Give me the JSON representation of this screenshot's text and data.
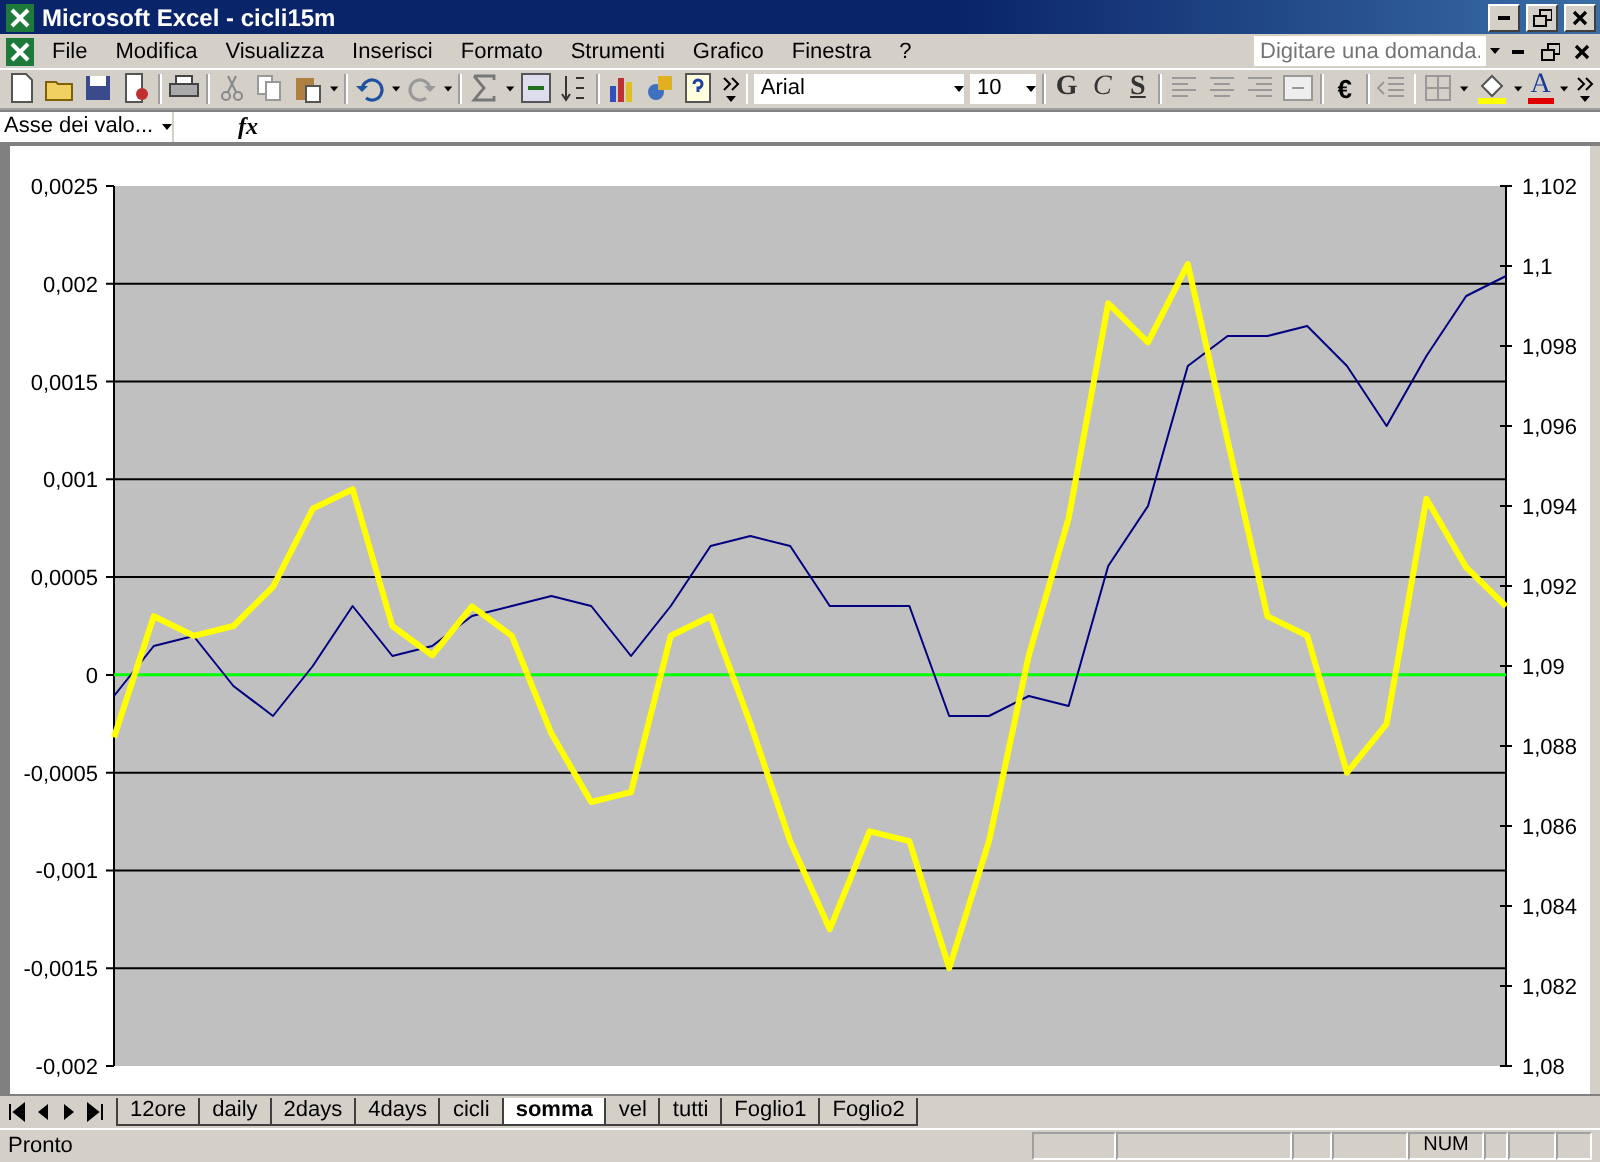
{
  "window": {
    "title": "Microsoft Excel - cicli15m"
  },
  "menu": [
    "File",
    "Modifica",
    "Visualizza",
    "Inserisci",
    "Formato",
    "Strumenti",
    "Grafico",
    "Finestra",
    "?"
  ],
  "help_box": {
    "placeholder": "Digitare una domanda."
  },
  "toolbar": {
    "font": "Arial",
    "font_size": "10",
    "format_buttons": [
      "G",
      "C",
      "S"
    ],
    "euro": "€",
    "font_color": "A"
  },
  "formula_bar": {
    "name_box": "Asse dei valo...",
    "fx": "fx"
  },
  "chart": {
    "chart_data": {
      "type": "line",
      "grid": true,
      "ylim": [
        -0.002,
        0.0025
      ],
      "yticks": [
        {
          "value": 0.0025,
          "label": "0,0025"
        },
        {
          "value": 0.002,
          "label": "0,002"
        },
        {
          "value": 0.0015,
          "label": "0,0015"
        },
        {
          "value": 0.001,
          "label": "0,001"
        },
        {
          "value": 0.0005,
          "label": "0,0005"
        },
        {
          "value": 0,
          "label": "0"
        },
        {
          "value": -0.0005,
          "label": "-0,0005"
        },
        {
          "value": -0.001,
          "label": "-0,001"
        },
        {
          "value": -0.0015,
          "label": "-0,0015"
        },
        {
          "value": -0.002,
          "label": "-0,002"
        }
      ],
      "y2lim": [
        1.08,
        1.102
      ],
      "y2ticks": [
        {
          "value": 1.102,
          "label": "1,102"
        },
        {
          "value": 1.1,
          "label": "1,1"
        },
        {
          "value": 1.098,
          "label": "1,098"
        },
        {
          "value": 1.096,
          "label": "1,096"
        },
        {
          "value": 1.094,
          "label": "1,094"
        },
        {
          "value": 1.092,
          "label": "1,092"
        },
        {
          "value": 1.09,
          "label": "1,09"
        },
        {
          "value": 1.088,
          "label": "1,088"
        },
        {
          "value": 1.086,
          "label": "1,086"
        },
        {
          "value": 1.084,
          "label": "1,084"
        },
        {
          "value": 1.082,
          "label": "1,082"
        },
        {
          "value": 1.08,
          "label": "1,08"
        }
      ],
      "series": [
        {
          "color": "#00ff00",
          "values": [
            0,
            0,
            0,
            0,
            0,
            0,
            0,
            0,
            0,
            0,
            0,
            0,
            0,
            0,
            0,
            0,
            0,
            0,
            0,
            0,
            0,
            0,
            0,
            0,
            0,
            0,
            0,
            0,
            0,
            0,
            0,
            0,
            0,
            0,
            0,
            0
          ]
        },
        {
          "color": "#000080",
          "axis": "y2",
          "values": [
            1.08925,
            1.0905,
            1.09075,
            1.0895,
            1.08875,
            1.09,
            1.0915,
            1.09025,
            1.0905,
            1.09125,
            1.0915,
            1.09175,
            1.0915,
            1.09025,
            1.0915,
            1.093,
            1.09325,
            1.093,
            1.0915,
            1.0915,
            1.0915,
            1.08875,
            1.08875,
            1.08925,
            1.089,
            1.0925,
            1.094,
            1.0975,
            1.09825,
            1.09825,
            1.0985,
            1.0975,
            1.096,
            1.09775,
            1.09925,
            1.09975
          ]
        },
        {
          "color": "#ffff00",
          "values": [
            -0.00032,
            0.0003,
            0.0002,
            0.00025,
            0.00045,
            0.00085,
            0.00095,
            0.00025,
            0.0001,
            0.00035,
            0.0002,
            -0.0003,
            -0.00065,
            -0.0006,
            0.0002,
            0.0003,
            -0.00025,
            -0.00085,
            -0.0013,
            -0.0008,
            -0.00085,
            -0.0015,
            -0.00085,
            0.0001,
            0.0008,
            0.0019,
            0.0017,
            0.0021,
            0.0012,
            0.0003,
            0.0002,
            -0.0005,
            -0.00025,
            0.0009,
            0.00055,
            0.00035
          ]
        }
      ]
    }
  },
  "sheet_tabs": [
    {
      "label": "12ore",
      "selected": false
    },
    {
      "label": "daily",
      "selected": false
    },
    {
      "label": "2days",
      "selected": false
    },
    {
      "label": "4days",
      "selected": false
    },
    {
      "label": "cicli",
      "selected": false
    },
    {
      "label": "somma",
      "selected": true
    },
    {
      "label": "vel",
      "selected": false
    },
    {
      "label": "tutti",
      "selected": false
    },
    {
      "label": "Foglio1",
      "selected": false
    },
    {
      "label": "Foglio2",
      "selected": false
    }
  ],
  "status_bar": {
    "status": "Pronto",
    "indicator": "NUM"
  }
}
